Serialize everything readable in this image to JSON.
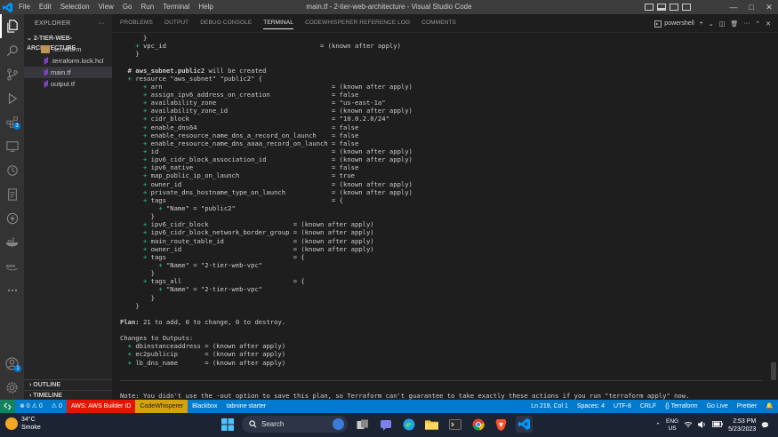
{
  "window": {
    "title": "main.tf - 2-tier-web-architecture - Visual Studio Code",
    "menu": [
      "File",
      "Edit",
      "Selection",
      "View",
      "Go",
      "Run",
      "Terminal",
      "Help"
    ]
  },
  "activity": {
    "extensions_badge": "3"
  },
  "sidebar": {
    "header": "EXPLORER",
    "header_more": "···",
    "project": "2-TIER-WEB-ARCHITECTURE",
    "items": [
      {
        "label": ".terraform",
        "type": "folder"
      },
      {
        "label": ".terraform.lock.hcl",
        "type": "tf"
      },
      {
        "label": "main.tf",
        "type": "tf"
      },
      {
        "label": "output.tf",
        "type": "tf"
      }
    ],
    "outline": "OUTLINE",
    "timeline": "TIMELINE"
  },
  "panel": {
    "tabs": [
      "PROBLEMS",
      "OUTPUT",
      "DEBUG CONSOLE",
      "TERMINAL",
      "CODEWHISPERER REFERENCE LOG",
      "COMMENTS"
    ],
    "active_tab": "TERMINAL",
    "shell": "powershell",
    "add": "+",
    "more": "···"
  },
  "terminal": {
    "lines": [
      {
        "t": "      }"
      },
      {
        "p": "    + ",
        "t": "vpc_id                                        = (known after apply)"
      },
      {
        "t": "    }"
      },
      {
        "t": ""
      },
      {
        "hdr": "  # aws_subnet.public2",
        "t": " will be created"
      },
      {
        "p": "  + ",
        "t": "resource \"aws_subnet\" \"public2\" {"
      },
      {
        "p": "      + ",
        "t": "arn                                            = (known after apply)"
      },
      {
        "p": "      + ",
        "t": "assign_ipv6_address_on_creation                = false"
      },
      {
        "p": "      + ",
        "t": "availability_zone                              = \"us-east-1a\""
      },
      {
        "p": "      + ",
        "t": "availability_zone_id                           = (known after apply)"
      },
      {
        "p": "      + ",
        "t": "cidr_block                                     = \"10.0.2.0/24\""
      },
      {
        "p": "      + ",
        "t": "enable_dns64                                   = false"
      },
      {
        "p": "      + ",
        "t": "enable_resource_name_dns_a_record_on_launch    = false"
      },
      {
        "p": "      + ",
        "t": "enable_resource_name_dns_aaaa_record_on_launch = false"
      },
      {
        "p": "      + ",
        "t": "id                                             = (known after apply)"
      },
      {
        "p": "      + ",
        "t": "ipv6_cidr_block_association_id                 = (known after apply)"
      },
      {
        "p": "      + ",
        "t": "ipv6_native                                    = false"
      },
      {
        "p": "      + ",
        "t": "map_public_ip_on_launch                        = true"
      },
      {
        "p": "      + ",
        "t": "owner_id                                       = (known after apply)"
      },
      {
        "p": "      + ",
        "t": "private_dns_hostname_type_on_launch            = (known after apply)"
      },
      {
        "p": "      + ",
        "t": "tags                                           = {"
      },
      {
        "p": "          + ",
        "t": "\"Name\" = \"public2\""
      },
      {
        "t": "        }"
      },
      {
        "p": "      + ",
        "t": "ipv6_cidr_block                      = (known after apply)"
      },
      {
        "p": "      + ",
        "t": "ipv6_cidr_block_network_border_group = (known after apply)"
      },
      {
        "p": "      + ",
        "t": "main_route_table_id                  = (known after apply)"
      },
      {
        "p": "      + ",
        "t": "owner_id                             = (known after apply)"
      },
      {
        "p": "      + ",
        "t": "tags                                 = {"
      },
      {
        "p": "          + ",
        "t": "\"Name\" = \"2-tier-web-vpc\""
      },
      {
        "t": "        }"
      },
      {
        "p": "      + ",
        "t": "tags_all                             = {"
      },
      {
        "p": "          + ",
        "t": "\"Name\" = \"2-tier-web-vpc\""
      },
      {
        "t": "        }"
      },
      {
        "t": "    }"
      },
      {
        "t": ""
      },
      {
        "bold": "Plan:",
        "t": " 21 to add, 0 to change, 0 to destroy."
      },
      {
        "t": ""
      },
      {
        "t": "Changes to Outputs:"
      },
      {
        "p": "  + ",
        "t": "dbinstanceaddress = (known after apply)"
      },
      {
        "p": "  + ",
        "t": "ec2publicip       = (known after apply)"
      },
      {
        "p": "  + ",
        "t": "lb_dns_name       = (known after apply)"
      }
    ],
    "note": "Note: You didn't use the -out option to save this plan, so Terraform can't guarantee to take exactly these actions if you run \"terraform apply\" now."
  },
  "status": {
    "problems": "⊗ 0 ⚠ 0",
    "warnings_alt": "⚠ 0",
    "aws": "AWS: AWS Builder ID",
    "codewhisperer": "CodeWhisperer",
    "blackbox": "Blackbox",
    "tabnine": "tabnine starter",
    "position": "Ln 219, Col 1",
    "spaces": "Spaces: 4",
    "encoding": "UTF-8",
    "eol": "CRLF",
    "lang": "{} Terraform",
    "golive": "Go Live",
    "prettier": "Prettier"
  },
  "taskbar": {
    "temp": "34°C",
    "weather": "Smoke",
    "search": "Search",
    "lang_top": "ENG",
    "lang_bottom": "US",
    "time": "2:53 PM",
    "date": "5/23/2023"
  }
}
